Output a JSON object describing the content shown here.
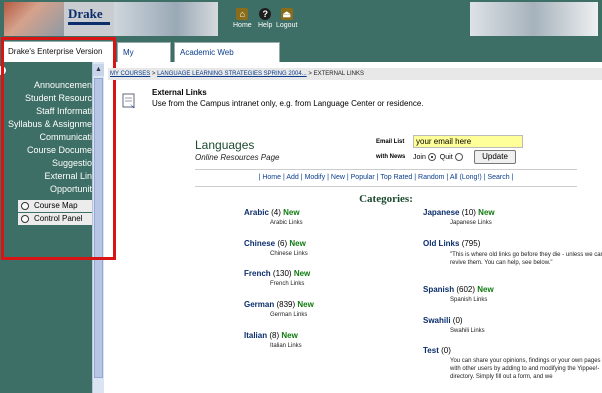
{
  "header": {
    "logo_text": "Drake",
    "nav": [
      {
        "label": "Home",
        "icon": "home-icon"
      },
      {
        "label": "Help",
        "icon": "help-icon"
      },
      {
        "label": "Logout",
        "icon": "logout-icon"
      }
    ]
  },
  "tabs": [
    {
      "label": "Drake's Enterprise Version",
      "active": true
    },
    {
      "label": "My Courses",
      "active": false
    },
    {
      "label": "Academic Web Resources",
      "active": false
    }
  ],
  "sidebar": {
    "items": [
      "Announcemen",
      "Student Resourc",
      "Staff Informati",
      "Syllabus & Assignme",
      "Communicati",
      "Course Docume",
      "Suggestio",
      "External Lin",
      "Opportunit"
    ],
    "buttons": [
      "Course Map",
      "Control Panel"
    ]
  },
  "breadcrumb": {
    "link1": "MY COURSES",
    "link2": "LANGUAGE LEARNING STRATEGIES SPRING 2004...",
    "current": "EXTERNAL LINKS",
    "sep": ">"
  },
  "content": {
    "title": "External Links",
    "description": "Use from the Campus intranet only, e.g. from Language Center or residence."
  },
  "languages": {
    "title": "Languages",
    "subtitle": "Online Resources Page",
    "email_label": "Email List",
    "email_value": "your email here",
    "news_label": "with News",
    "join_label": "Join",
    "quit_label": "Quit",
    "update_label": "Update"
  },
  "menu": [
    "Home",
    "Add",
    "Modify",
    "New",
    "Popular",
    "Top Rated",
    "Random",
    "All (Long!)",
    "Search"
  ],
  "categories_title": "Categories:",
  "new_label": "New",
  "categories_left": [
    {
      "name": "Arabic",
      "count": "(4)",
      "new": true,
      "sub": "Arabic Links"
    },
    {
      "name": "Chinese",
      "count": "(6)",
      "new": true,
      "sub": "Chinese Links"
    },
    {
      "name": "French",
      "count": "(130)",
      "new": true,
      "sub": "French Links"
    },
    {
      "name": "German",
      "count": "(839)",
      "new": true,
      "sub": "German Links"
    },
    {
      "name": "Italian",
      "count": "(8)",
      "new": true,
      "sub": "Italian Links"
    }
  ],
  "categories_right": [
    {
      "name": "Japanese",
      "count": "(10)",
      "new": true,
      "sub": "Japanese Links"
    },
    {
      "name": "Old Links",
      "count": "(795)",
      "new": false,
      "sub": "\"This is where old links go before they die - unless we can revive them. You can help, see below.\""
    },
    {
      "name": "Spanish",
      "count": "(602)",
      "new": true,
      "sub": "Spanish Links"
    },
    {
      "name": "Swahili",
      "count": "(0)",
      "new": false,
      "sub": "Swahili Links"
    },
    {
      "name": "Test",
      "count": "(0)",
      "new": false,
      "sub": "You can share your opinions, findings or your own pages with other users by adding to and modifying the Yippee!-directory. Simply fill out a form, and we"
    }
  ],
  "colors": {
    "header_bg": "#3e6f66",
    "highlight": "#d81414",
    "new": "#0f7a0f",
    "link": "#0b2e6b",
    "email_bg": "#ffff99"
  }
}
